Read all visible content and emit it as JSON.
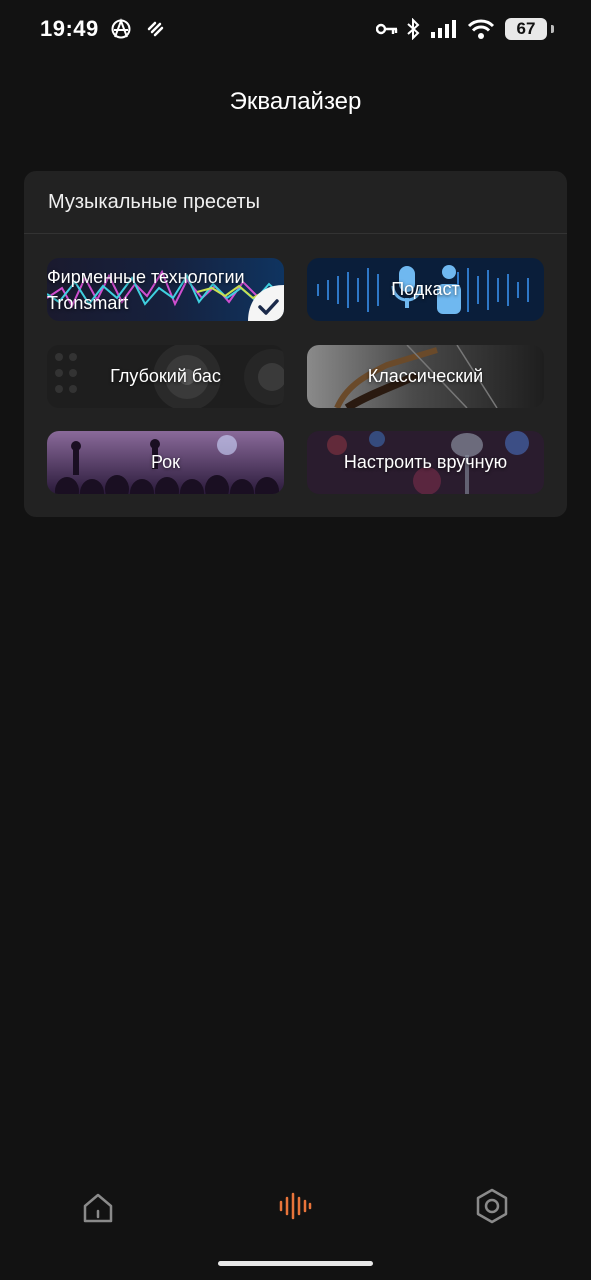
{
  "status_bar": {
    "time": "19:49",
    "battery": "67"
  },
  "header": {
    "title": "Эквалайзер"
  },
  "presets_card": {
    "title": "Музыкальные пресеты",
    "items": [
      {
        "label": "Фирменные технологии Tronsmart",
        "selected": true
      },
      {
        "label": "Подкаст",
        "selected": false
      },
      {
        "label": "Глубокий бас",
        "selected": false
      },
      {
        "label": "Классический",
        "selected": false
      },
      {
        "label": "Рок",
        "selected": false
      },
      {
        "label": "Настроить вручную",
        "selected": false
      }
    ]
  },
  "bottom_nav": {
    "items": [
      {
        "icon": "home-icon",
        "active": false
      },
      {
        "icon": "equalizer-icon",
        "active": true
      },
      {
        "icon": "settings-icon",
        "active": false
      }
    ],
    "active_color": "#e8743a",
    "inactive_color": "#8a8a8a"
  }
}
